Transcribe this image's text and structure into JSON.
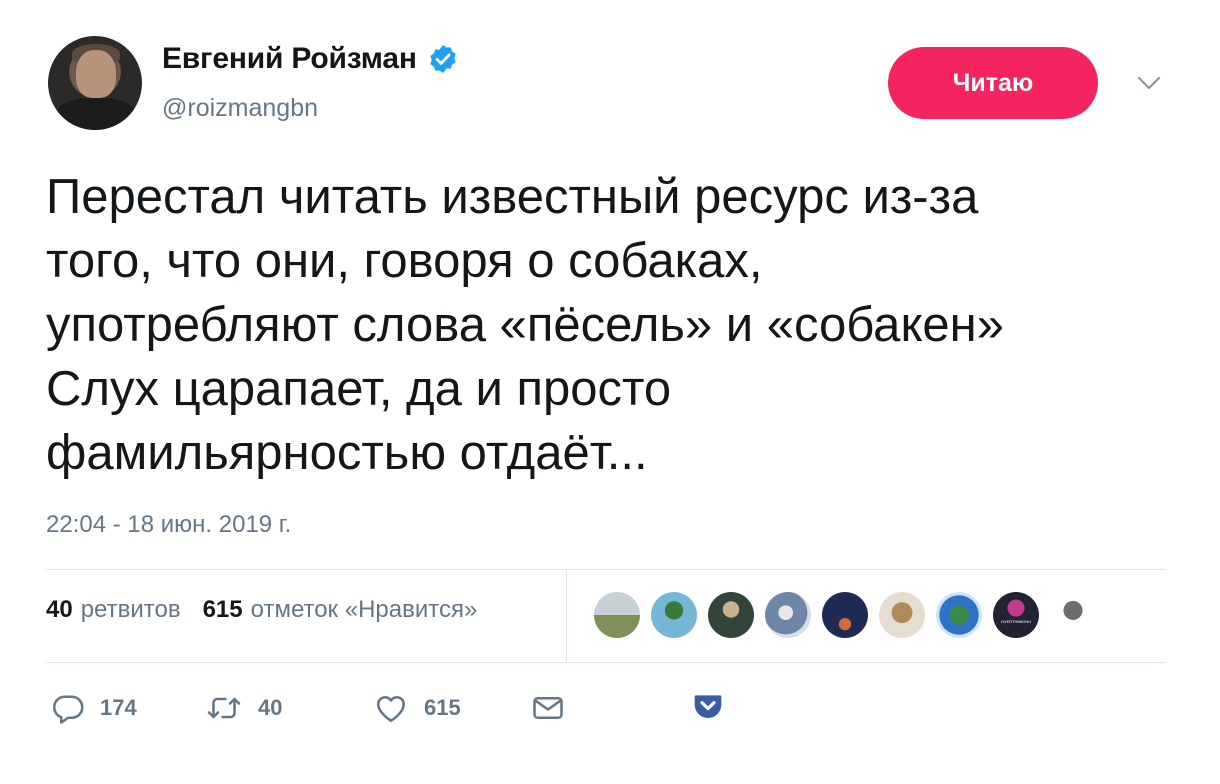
{
  "author": {
    "name": "Евгений Ройзман",
    "handle": "@roizmangbn",
    "verified": true
  },
  "follow_button": {
    "label": "Читаю",
    "color": "#f4245e"
  },
  "tweet": {
    "text": "Перестал читать известный ресурс из-за\nтого, что они, говоря о собаках,\nупотребляют слова «пёсель» и «собакен»\nСлух царапает, да и просто\nфамильярностью отдаёт...",
    "timestamp": "22:04 - 18 июн. 2019 г."
  },
  "stats": {
    "retweets_count": "40",
    "retweets_label": "ретвитов",
    "likes_count": "615",
    "likes_label": "отметок «Нравится»"
  },
  "liker_avatars": [
    "field-avatar",
    "palm-avatar",
    "person-avatar",
    "illustration-avatar",
    "city-night-avatar",
    "cat-avatar",
    "globe-avatar",
    "overthinking-avatar",
    "statue-avatar"
  ],
  "liker_avatar_text": "OVERTHINKING",
  "actions": {
    "reply_count": "174",
    "retweet_count": "40",
    "like_count": "615"
  },
  "colors": {
    "accent": "#1da1f2",
    "muted": "#657786",
    "text": "#14171a"
  }
}
